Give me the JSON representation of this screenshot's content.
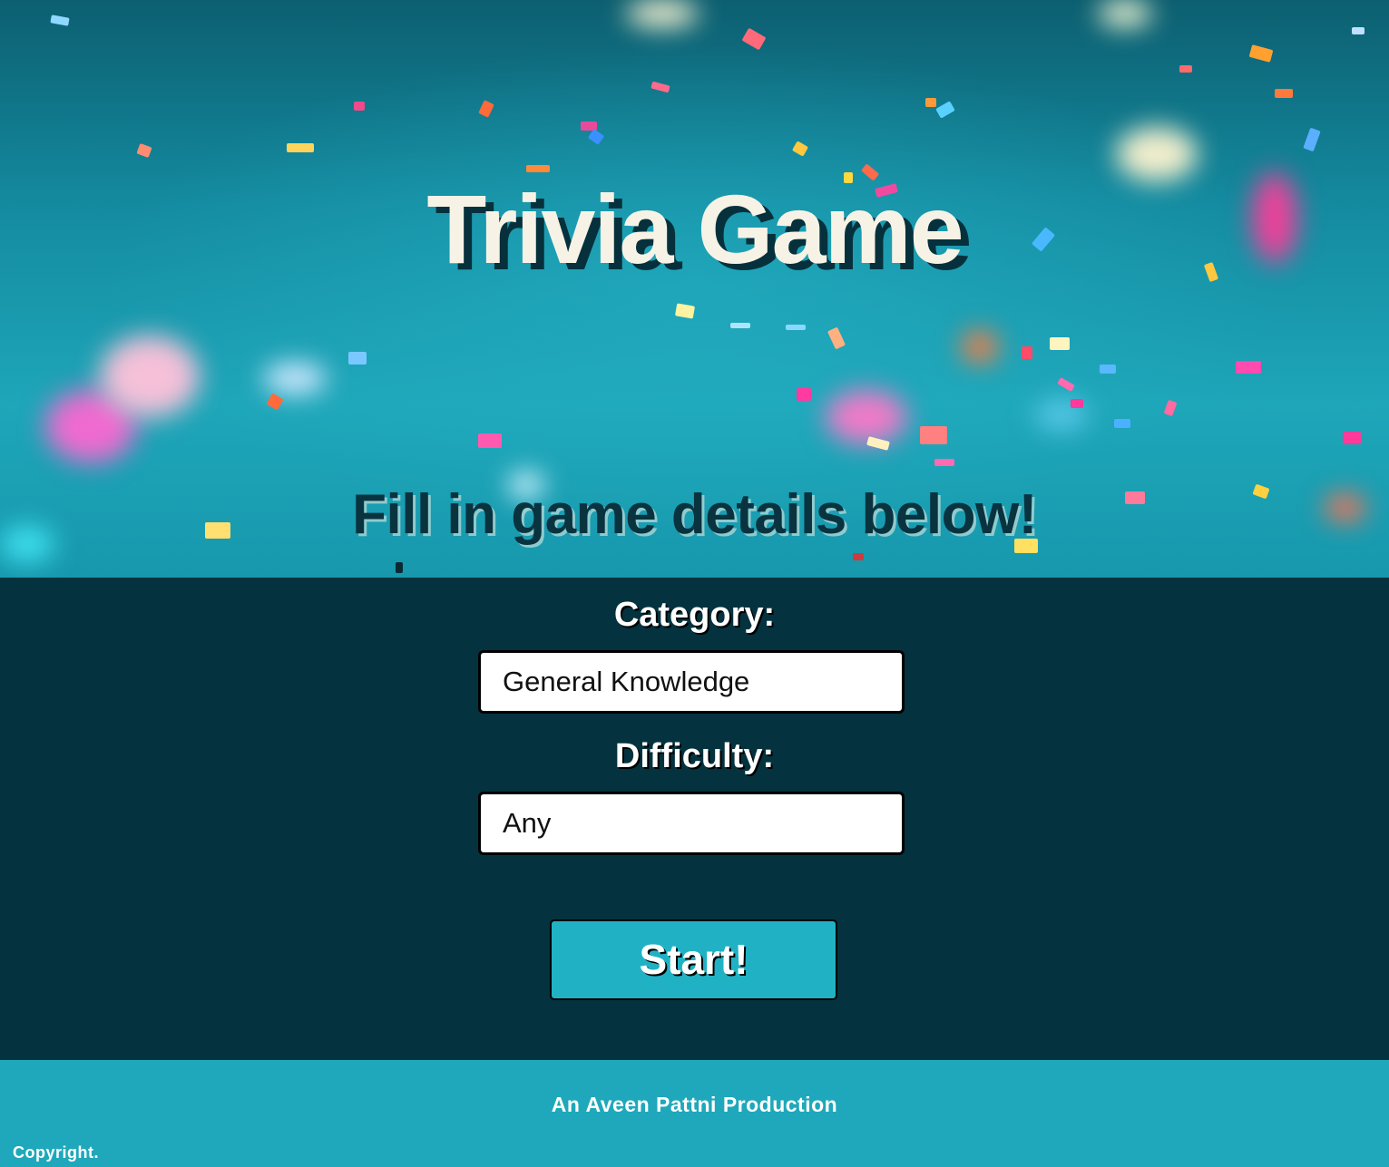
{
  "header": {
    "title": "Trivia Game",
    "subtitle": "Fill in game details below!"
  },
  "form": {
    "category_label": "Category:",
    "category_value": "General Knowledge",
    "difficulty_label": "Difficulty:",
    "difficulty_value": "Any",
    "start_label": "Start!"
  },
  "footer": {
    "credit": "An Aveen Pattni Production",
    "copyright": "Copyright."
  },
  "colors": {
    "hero_teal": "#1ea6b9",
    "form_background": "#04323f",
    "start_button": "#20b2c4",
    "footer_background": "#1fa8bb",
    "title_text": "#f6f3e6"
  }
}
